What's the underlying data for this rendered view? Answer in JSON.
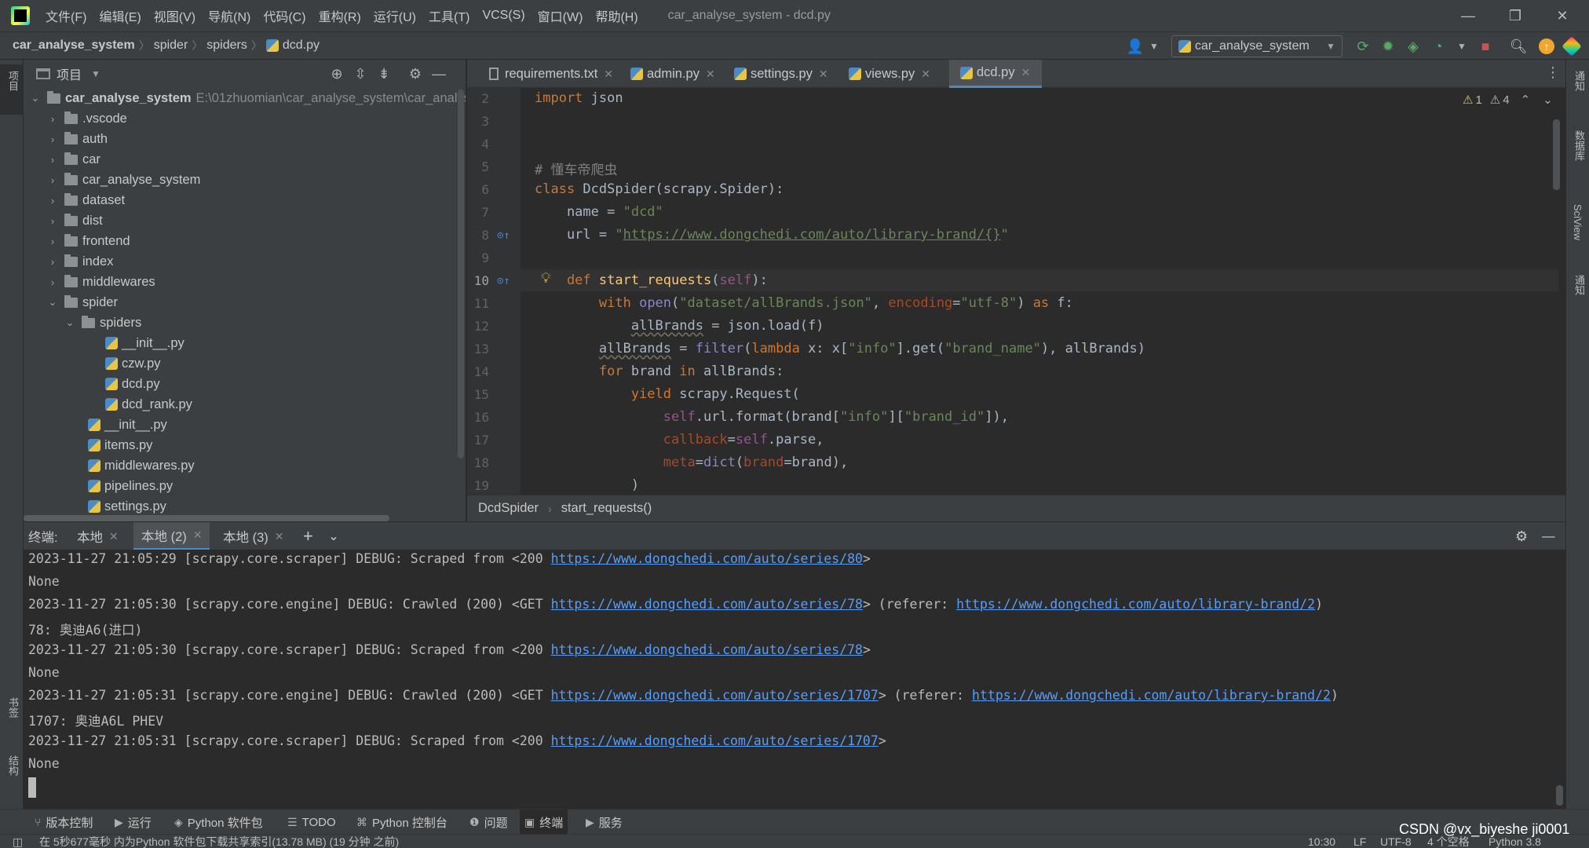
{
  "menubar": {
    "items": [
      "文件(F)",
      "编辑(E)",
      "视图(V)",
      "导航(N)",
      "代码(C)",
      "重构(R)",
      "运行(U)",
      "工具(T)",
      "VCS(S)",
      "窗口(W)",
      "帮助(H)"
    ],
    "window_title": "car_analyse_system - dcd.py",
    "controls": {
      "minimize": "—",
      "restore": "❐",
      "close": "✕"
    }
  },
  "navbar": {
    "crumbs": [
      "car_analyse_system",
      "spider",
      "spiders",
      "dcd.py"
    ],
    "run_config": "car_analyse_system",
    "icons": [
      "user-icon",
      "run-config-icon",
      "rebuild-icon",
      "debug-icon",
      "coverage-icon",
      "profile-icon",
      "stop-icon",
      "search-icon",
      "update-icon",
      "jetbrains-icon"
    ]
  },
  "project": {
    "title": "项目",
    "root_name": "car_analyse_system",
    "root_path": "E:\\01zhuomian\\car_analyse_system\\car_analys",
    "items": [
      {
        "label": ".vscode",
        "type": "folder"
      },
      {
        "label": "auth",
        "type": "folder"
      },
      {
        "label": "car",
        "type": "folder"
      },
      {
        "label": "car_analyse_system",
        "type": "folder"
      },
      {
        "label": "dataset",
        "type": "folder"
      },
      {
        "label": "dist",
        "type": "folder"
      },
      {
        "label": "frontend",
        "type": "folder"
      },
      {
        "label": "index",
        "type": "folder"
      },
      {
        "label": "middlewares",
        "type": "folder"
      },
      {
        "label": "spider",
        "type": "folder"
      },
      {
        "label": "spiders",
        "type": "folder"
      },
      {
        "label": "__init__.py",
        "type": "file"
      },
      {
        "label": "czw.py",
        "type": "file"
      },
      {
        "label": "dcd.py",
        "type": "file"
      },
      {
        "label": "dcd_rank.py",
        "type": "file"
      },
      {
        "label": "__init__.py",
        "type": "file"
      },
      {
        "label": "items.py",
        "type": "file"
      },
      {
        "label": "middlewares.py",
        "type": "file"
      },
      {
        "label": "pipelines.py",
        "type": "file"
      },
      {
        "label": "settings.py",
        "type": "file"
      }
    ]
  },
  "editor": {
    "tabs": [
      "requirements.txt",
      "admin.py",
      "settings.py",
      "views.py",
      "dcd.py"
    ],
    "active_tab": "dcd.py",
    "inspections": {
      "warnings": "1",
      "weak_warnings": "4"
    },
    "line_numbers": [
      "2",
      "3",
      "4",
      "5",
      "6",
      "7",
      "8",
      "9",
      "10",
      "11",
      "12",
      "13",
      "14",
      "15",
      "16",
      "17",
      "18",
      "19"
    ],
    "breadcrumbs": [
      "DcdSpider",
      "start_requests()"
    ],
    "code": {
      "l2_kw": "import",
      "l2_rest": " json",
      "l5": "# 懂车帝爬虫",
      "l6_kw": "class",
      "l6_name": " DcdSpider",
      "l6_rest": "(scrapy.Spider):",
      "l7_a": "    name = ",
      "l7_str": "\"dcd\"",
      "l8_a": "    url = ",
      "l8_q1": "\"",
      "l8_url": "https://www.dongchedi.com/auto/library-brand/{}",
      "l8_q2": "\"",
      "l10_kw": "    def",
      "l10_fn": " start_requests",
      "l10_p1": "(",
      "l10_self": "self",
      "l10_p2": "):",
      "l11_kw": "        with",
      "l11_a": " ",
      "l11_bi": "open",
      "l11_b": "(",
      "l11_str": "\"dataset/allBrands.json\"",
      "l11_c": ", ",
      "l11_par": "encoding",
      "l11_d": "=",
      "l11_str2": "\"utf-8\"",
      "l11_e": ") ",
      "l11_kw2": "as",
      "l11_f": " f:",
      "l12_a": "            ",
      "l12_var": "allBrands",
      "l12_b": " = json.load(f)",
      "l13_a": "        ",
      "l13_var": "allBrands",
      "l13_b": " = ",
      "l13_bi": "filter",
      "l13_c": "(",
      "l13_kw": "lambda",
      "l13_d": " x: x[",
      "l13_str": "\"info\"",
      "l13_e": "].get(",
      "l13_str2": "\"brand_name\"",
      "l13_f": "), allBrands)",
      "l14_kw": "        for",
      "l14_a": " brand ",
      "l14_kw2": "in",
      "l14_b": " allBrands:",
      "l15_kw": "            yield",
      "l15_a": " scrapy.Request(",
      "l16_a": "                ",
      "l16_self": "self",
      "l16_b": ".url.format(brand[",
      "l16_str": "\"info\"",
      "l16_c": "][",
      "l16_str2": "\"brand_id\"",
      "l16_d": "]),",
      "l17_a": "                ",
      "l17_par": "callback",
      "l17_b": "=",
      "l17_self": "self",
      "l17_c": ".parse,",
      "l18_a": "                ",
      "l18_par": "meta",
      "l18_b": "=",
      "l18_bi": "dict",
      "l18_c": "(",
      "l18_par2": "brand",
      "l18_d": "=brand),",
      "l19": "            )"
    }
  },
  "terminal": {
    "label": "终端:",
    "tabs": [
      "本地",
      "本地 (2)",
      "本地 (3)"
    ],
    "active_tab": "本地 (2)",
    "lines": [
      {
        "pre": "2023-11-27 21:05:29 [scrapy.core.scraper] DEBUG: Scraped from <200 ",
        "link": "https://www.dongchedi.com/auto/series/80",
        "post": ">"
      },
      {
        "pre": "None"
      },
      {
        "pre": "2023-11-27 21:05:30 [scrapy.core.engine] DEBUG: Crawled (200) <GET ",
        "link": "https://www.dongchedi.com/auto/series/78",
        "post": "> (referer: ",
        "link2": "https://www.dongchedi.com/auto/library-brand/2",
        "post2": ")"
      },
      {
        "pre": "78: 奥迪A6(进口)"
      },
      {
        "pre": "2023-11-27 21:05:30 [scrapy.core.scraper] DEBUG: Scraped from <200 ",
        "link": "https://www.dongchedi.com/auto/series/78",
        "post": ">"
      },
      {
        "pre": "None"
      },
      {
        "pre": "2023-11-27 21:05:31 [scrapy.core.engine] DEBUG: Crawled (200) <GET ",
        "link": "https://www.dongchedi.com/auto/series/1707",
        "post": "> (referer: ",
        "link2": "https://www.dongchedi.com/auto/library-brand/2",
        "post2": ")"
      },
      {
        "pre": "1707: 奥迪A6L PHEV"
      },
      {
        "pre": "2023-11-27 21:05:31 [scrapy.core.scraper] DEBUG: Scraped from <200 ",
        "link": "https://www.dongchedi.com/auto/series/1707",
        "post": ">"
      },
      {
        "pre": "None"
      }
    ]
  },
  "toolwindows": [
    "版本控制",
    "运行",
    "Python 软件包",
    "TODO",
    "Python 控制台",
    "问题",
    "终端",
    "服务"
  ],
  "left_stripe": {
    "project": "项目",
    "bookmarks": "书签",
    "structure": "结构"
  },
  "right_stripe": {
    "notifications_top": "通知",
    "database": "数据库",
    "sciview": "SciView",
    "notifications": "通知"
  },
  "statusbar": {
    "message": "在 5秒677毫秒 内为Python 软件包下载共享索引(13.78 MB) (19 分钟 之前)",
    "position": "10:30",
    "line_sep": "LF",
    "encoding": "UTF-8",
    "indent": "4 个空格",
    "interpreter": "Python 3.8"
  },
  "watermark": "CSDN @vx_biyeshe ji0001"
}
